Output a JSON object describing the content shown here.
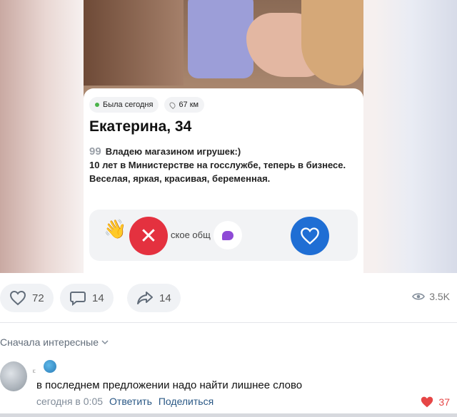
{
  "profile_card": {
    "status": "Была сегодня",
    "distance": "67 км",
    "name_age": "Екатерина, 34",
    "quote_mark": "99",
    "bio_line1": "Владею магазином игрушек:)",
    "bio_line2": "10 лет в Министерстве на госслужбе, теперь в бизнесе.",
    "bio_line3": "Веселая, яркая, красивая, беременная.",
    "partial_text": "ское общ",
    "wave_emoji": "👋",
    "dislike_symbol": "✕"
  },
  "post_stats": {
    "likes": "72",
    "comments": "14",
    "shares": "14",
    "views": "3.5K"
  },
  "comments_section": {
    "sort_label": "Сначала интересные",
    "comment": {
      "author_tag": "ι:",
      "text": "в последнем предложении надо найти лишнее слово",
      "time": "сегодня в 0:05",
      "reply": "Ответить",
      "share": "Поделиться",
      "like_count": "37"
    }
  },
  "colors": {
    "dislike": "#e4313f",
    "like": "#1f6ed4",
    "online": "#4bb34b",
    "link": "#2a5885",
    "heart": "#e64646"
  }
}
